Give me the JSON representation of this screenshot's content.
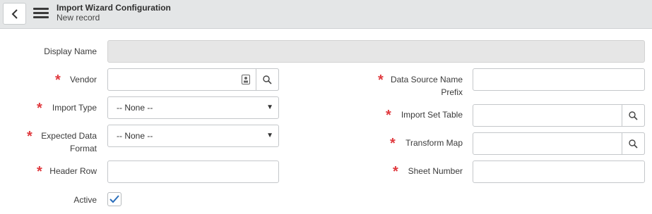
{
  "header": {
    "title": "Import Wizard Configuration",
    "subtitle": "New record"
  },
  "form": {
    "display_name": {
      "label": "Display Name",
      "value": ""
    },
    "vendor": {
      "label": "Vendor",
      "value": ""
    },
    "import_type": {
      "label": "Import Type",
      "selected": "-- None --"
    },
    "expected_data_format": {
      "label_line1": "Expected Data",
      "label_line2": "Format",
      "selected": "-- None --"
    },
    "header_row": {
      "label": "Header Row",
      "value": ""
    },
    "active": {
      "label": "Active",
      "checked": true
    },
    "data_source_name_prefix": {
      "label_line1": "Data Source Name",
      "label_line2": "Prefix",
      "value": ""
    },
    "import_set_table": {
      "label": "Import Set Table",
      "value": ""
    },
    "transform_map": {
      "label": "Transform Map",
      "value": ""
    },
    "sheet_number": {
      "label": "Sheet Number",
      "value": ""
    }
  },
  "colors": {
    "required": "#e0393e",
    "header_bg": "#e4e6e7",
    "checkbox_check": "#2a6ebb"
  },
  "required_marker": "*"
}
